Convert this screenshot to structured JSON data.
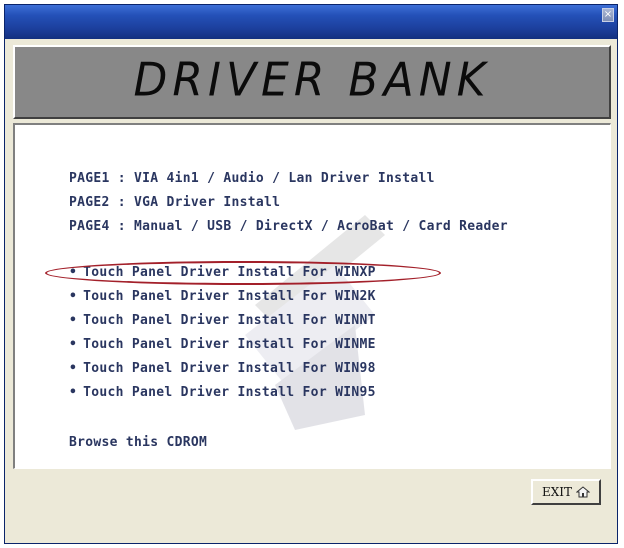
{
  "window": {
    "close_glyph": "×"
  },
  "banner": {
    "title": "DRIVER BANK"
  },
  "pages": [
    {
      "label": "PAGE1 : VIA 4in1 / Audio / Lan Driver Install"
    },
    {
      "label": "PAGE2 : VGA Driver Install"
    },
    {
      "label": "PAGE4 : Manual / USB / DirectX / AcroBat / Card Reader"
    }
  ],
  "touch_panel_bullet": "•",
  "touch_panel": [
    {
      "label": "Touch Panel Driver Install For WINXP"
    },
    {
      "label": "Touch Panel Driver Install For WIN2K"
    },
    {
      "label": "Touch Panel Driver Install For WINNT"
    },
    {
      "label": "Touch Panel Driver Install For WINME"
    },
    {
      "label": "Touch Panel Driver Install For WIN98"
    },
    {
      "label": "Touch Panel Driver Install For WIN95"
    }
  ],
  "browse": {
    "label": "Browse this CDROM"
  },
  "exit_button": {
    "label": "EXIT",
    "icon": "home-icon"
  },
  "colors": {
    "link_text": "#2a3660",
    "highlight": "#a3202a",
    "banner_bg": "#888888"
  }
}
